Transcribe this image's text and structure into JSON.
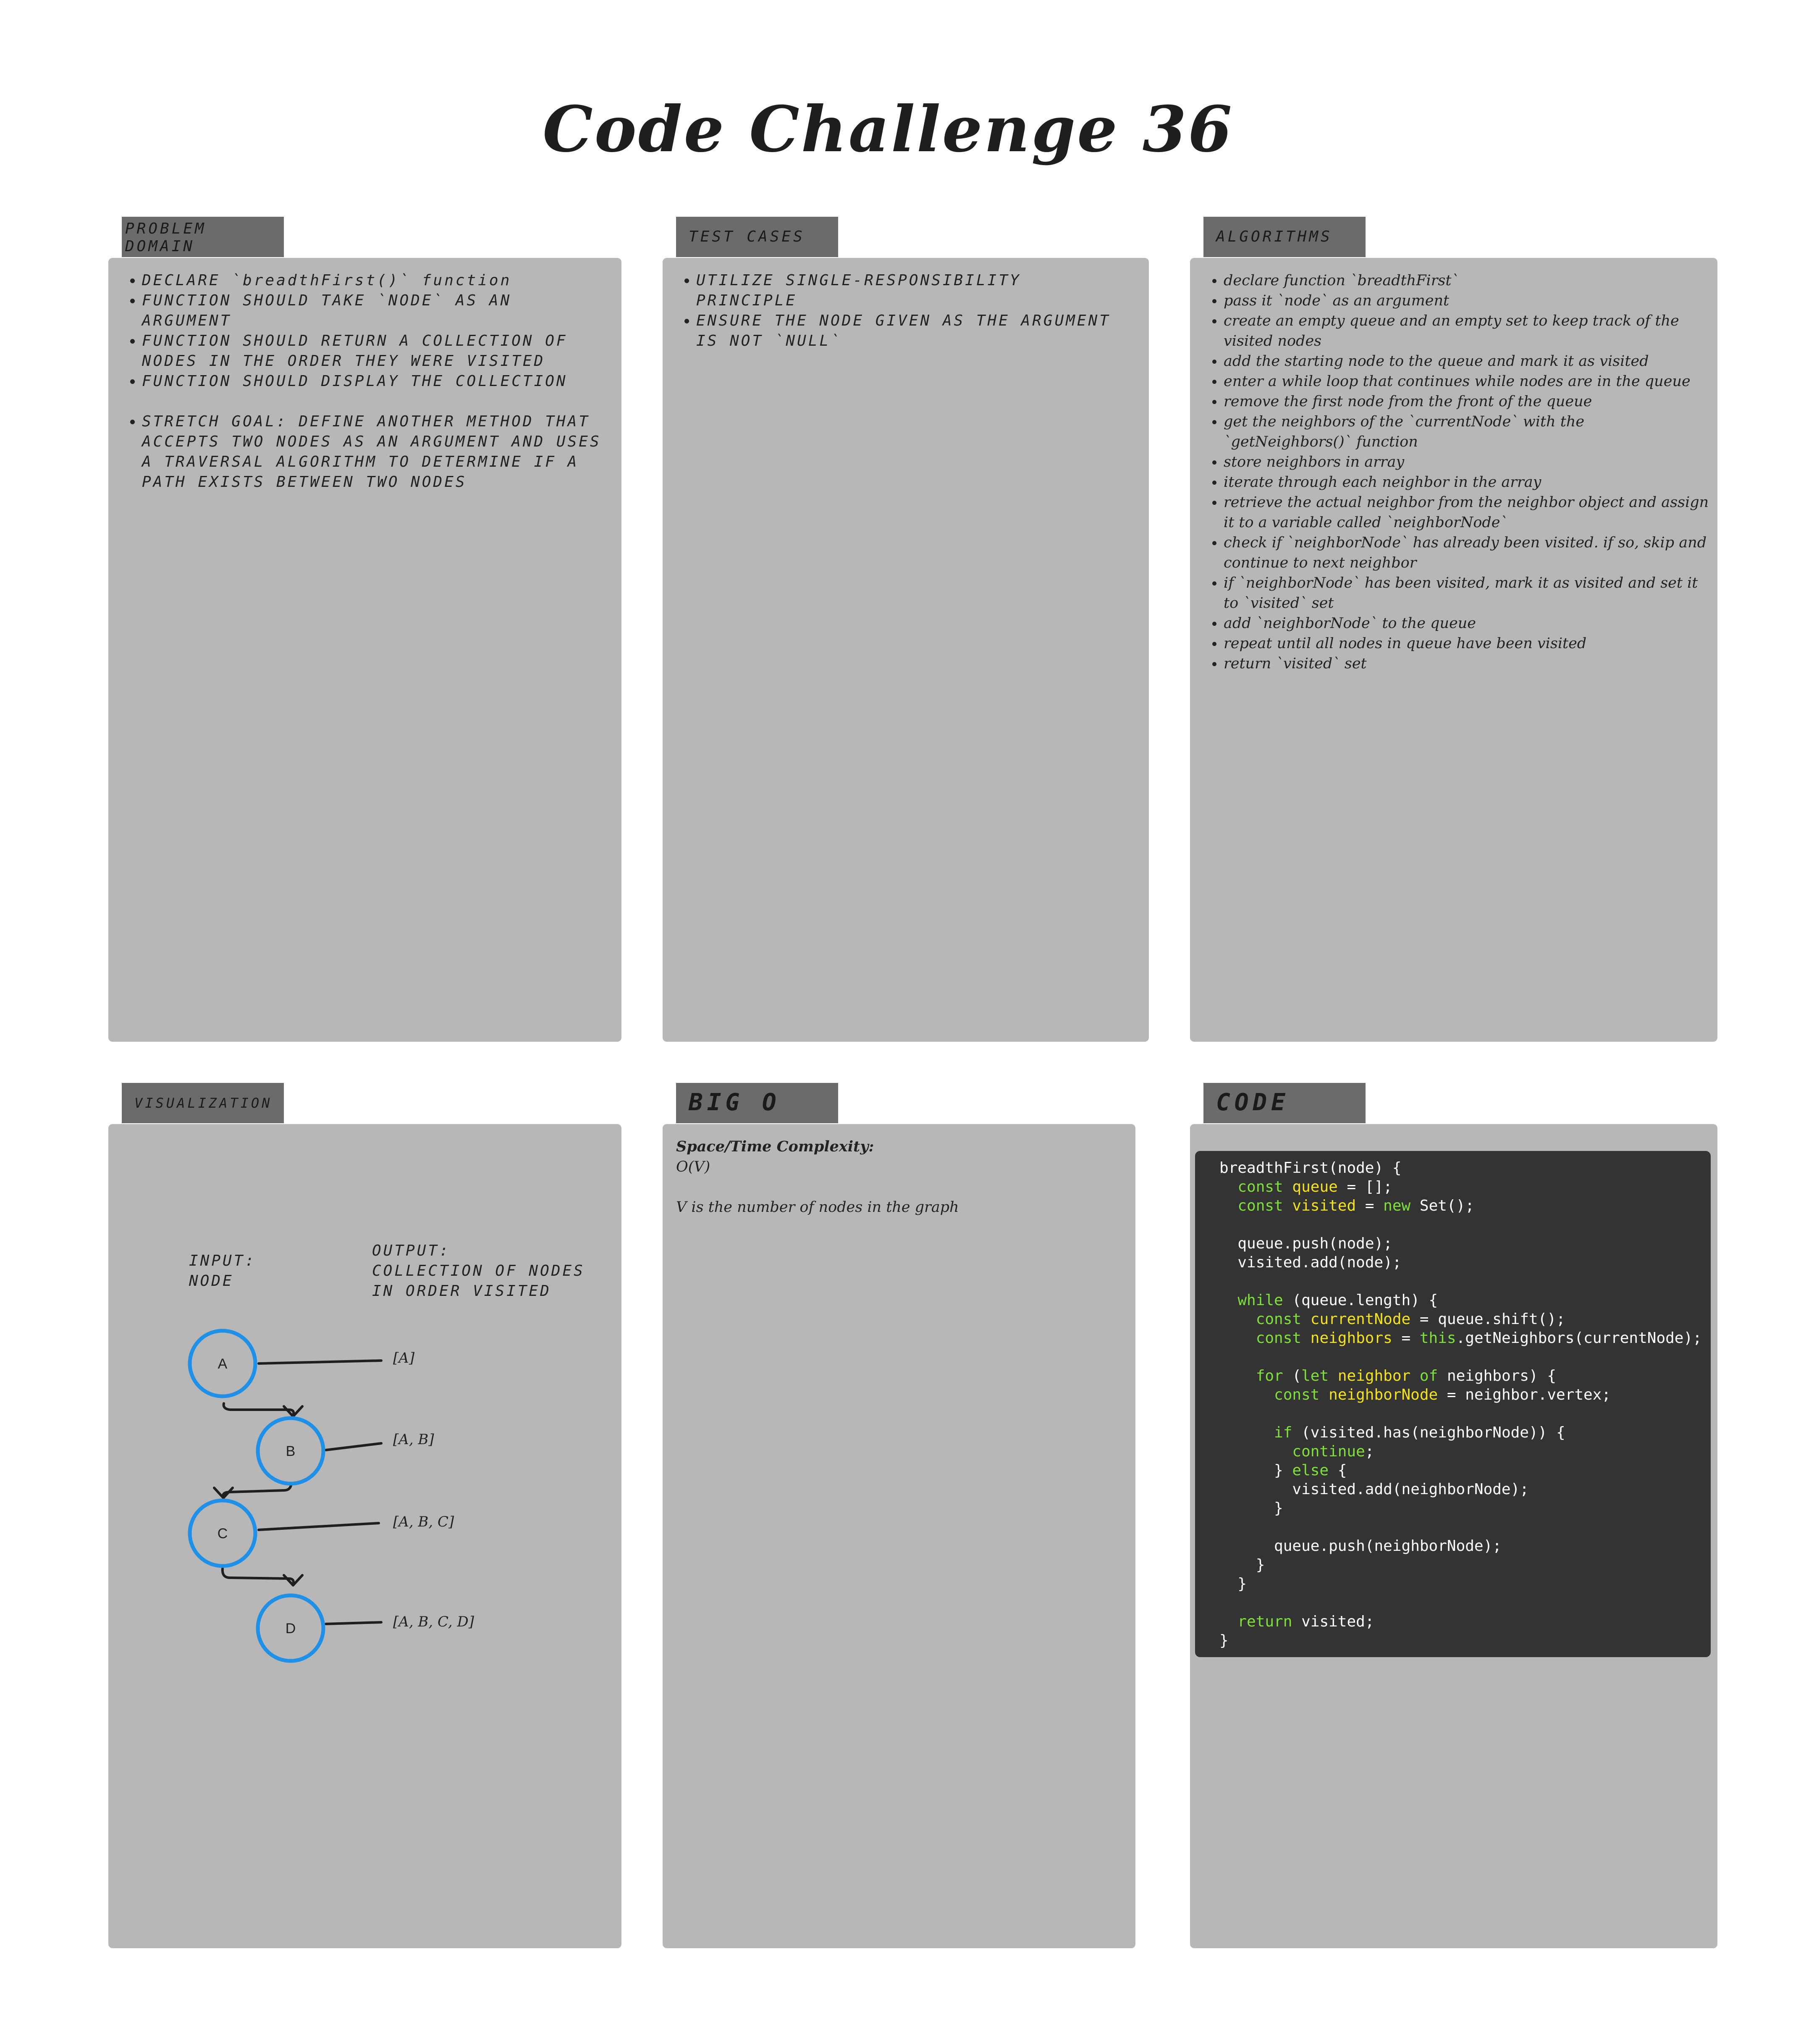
{
  "title": "Code Challenge 36",
  "problem_domain": {
    "tab": "PROBLEM\nDOMAIN",
    "items": [
      "DECLARE `breadthFirst()` function",
      "FUNCTION SHOULD TAKE `NODE` AS AN ARGUMENT",
      "FUNCTION SHOULD RETURN A COLLECTION OF NODES IN THE ORDER THEY WERE VISITED",
      "FUNCTION SHOULD DISPLAY THE COLLECTION",
      "STRETCH GOAL: DEFINE ANOTHER METHOD THAT ACCEPTS TWO NODES AS AN ARGUMENT AND USES A TRAVERSAL ALGORITHM TO DETERMINE IF A PATH EXISTS BETWEEN TWO NODES"
    ]
  },
  "test_cases": {
    "tab": "TEST CASES",
    "items": [
      "UTILIZE SINGLE-RESPONSIBILITY PRINCIPLE",
      "ENSURE THE NODE GIVEN AS THE ARGUMENT IS NOT `NULL`"
    ]
  },
  "algorithms": {
    "tab": "ALGORITHMS",
    "items": [
      "declare function `breadthFirst`",
      "pass it `node` as an argument",
      "create an empty queue and an empty set to keep track of the visited nodes",
      "add the starting node to the queue and mark it as visited",
      "enter a while loop that continues while nodes are in the queue",
      "remove the first node from the front of the queue",
      "get the neighbors of the `currentNode` with the `getNeighbors()` function",
      "store neighbors in array",
      "iterate through each neighbor in the array",
      "retrieve the actual neighbor from the neighbor object and assign it to a variable called `neighborNode`",
      "check if `neighborNode` has already been visited. if so, skip and continue to next neighbor",
      "if `neighborNode` has been visited, mark it as visited and set it to `visited` set",
      "add `neighborNode` to the queue",
      "repeat until all nodes in queue have been visited",
      "return `visited` set"
    ]
  },
  "visualization": {
    "tab": "VISUALIZATION",
    "input_label": "INPUT:\nNODE",
    "output_label": "OUTPUT:\nCOLLECTION OF NODES\nIN ORDER VISITED",
    "nodes": [
      "A",
      "B",
      "C",
      "D"
    ],
    "outputs": [
      "[A]",
      "[A, B]",
      "[A, B, C]",
      "[A, B, C, D]"
    ],
    "node_color": "#1e90e8"
  },
  "big_o": {
    "tab": "BIG O",
    "heading": "Space/Time Complexity:",
    "value": "O(V)",
    "note": "V is the number of nodes in the graph"
  },
  "code": {
    "tab": "CODE",
    "keyword_color": "#7fe03a",
    "variable_color": "#f4e21a",
    "lines": [
      "breadthFirst(node) {",
      "  const queue = [];",
      "  const visited = new Set();",
      "",
      "  queue.push(node);",
      "  visited.add(node);",
      "",
      "  while (queue.length) {",
      "    const currentNode = queue.shift();",
      "    const neighbors = this.getNeighbors(currentNode);",
      "",
      "    for (let neighbor of neighbors) {",
      "      const neighborNode = neighbor.vertex;",
      "",
      "      if (visited.has(neighborNode)) {",
      "        continue;",
      "      } else {",
      "        visited.add(neighborNode);",
      "      }",
      "",
      "      queue.push(neighborNode);",
      "    }",
      "  }",
      "",
      "  return visited;",
      "}"
    ]
  }
}
